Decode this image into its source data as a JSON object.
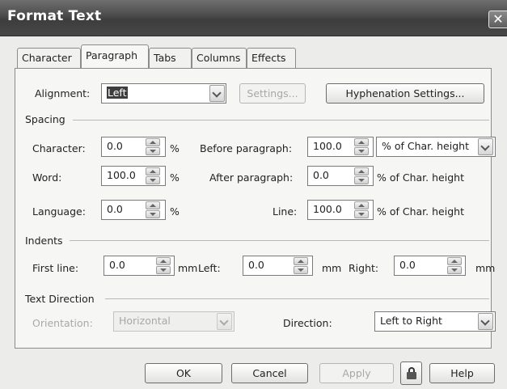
{
  "window": {
    "title": "Format Text",
    "close_glyph": "✕"
  },
  "tabs": [
    {
      "label": "Character",
      "active": false
    },
    {
      "label": "Paragraph",
      "active": true
    },
    {
      "label": "Tabs",
      "active": false
    },
    {
      "label": "Columns",
      "active": false
    },
    {
      "label": "Effects",
      "active": false
    }
  ],
  "alignment": {
    "label": "Alignment:",
    "value": "Left",
    "settings_label": "Settings...",
    "hyphenation_label": "Hyphenation Settings..."
  },
  "spacing": {
    "section": "Spacing",
    "character": {
      "label": "Character:",
      "value": "0.0",
      "unit": "%"
    },
    "word": {
      "label": "Word:",
      "value": "100.0",
      "unit": "%"
    },
    "language": {
      "label": "Language:",
      "value": "0.0",
      "unit": "%"
    },
    "before_paragraph": {
      "label": "Before paragraph:",
      "value": "100.0",
      "unit": "% of Char. height"
    },
    "after_paragraph": {
      "label": "After paragraph:",
      "value": "0.0",
      "unit": "% of Char. height"
    },
    "line": {
      "label": "Line:",
      "value": "100.0",
      "unit": "% of Char. height"
    }
  },
  "indents": {
    "section": "Indents",
    "first_line": {
      "label": "First line:",
      "value": "0.0",
      "unit": "mm"
    },
    "left": {
      "label": "Left:",
      "value": "0.0",
      "unit": "mm"
    },
    "right": {
      "label": "Right:",
      "value": "0.0",
      "unit": "mm"
    }
  },
  "text_direction": {
    "section": "Text Direction",
    "orientation_label": "Orientation:",
    "orientation_value": "Horizontal",
    "direction_label": "Direction:",
    "direction_value": "Left to Right"
  },
  "buttons": {
    "ok": "OK",
    "cancel": "Cancel",
    "apply": "Apply",
    "help": "Help"
  },
  "icons": {
    "lock": "lock-icon",
    "close": "close-icon"
  }
}
